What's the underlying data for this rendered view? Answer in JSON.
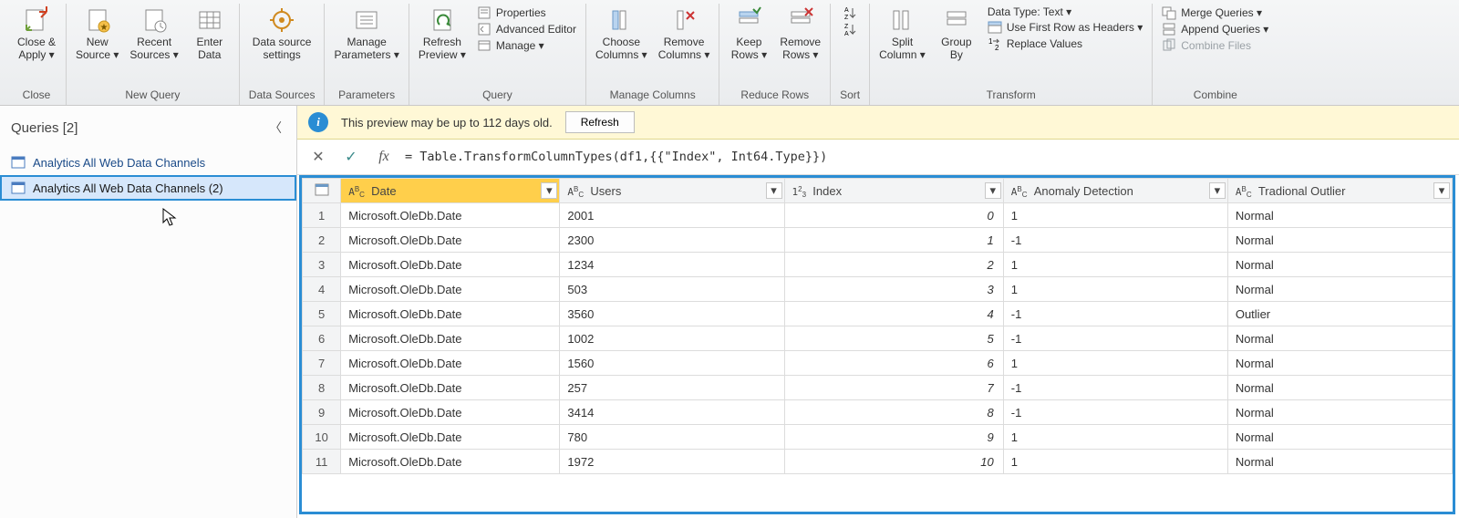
{
  "ribbon": {
    "close": {
      "close_apply": "Close &\nApply ▾",
      "group": "Close"
    },
    "newquery": {
      "new_source": "New\nSource ▾",
      "recent": "Recent\nSources ▾",
      "enter": "Enter\nData",
      "group": "New Query"
    },
    "datasources": {
      "btn": "Data source\nsettings",
      "group": "Data Sources"
    },
    "parameters": {
      "btn": "Manage\nParameters ▾",
      "group": "Parameters"
    },
    "query": {
      "refresh": "Refresh\nPreview ▾",
      "props": "Properties",
      "adv": "Advanced Editor",
      "manage": "Manage ▾",
      "group": "Query"
    },
    "managecols": {
      "choose": "Choose\nColumns ▾",
      "remove": "Remove\nColumns ▾",
      "group": "Manage Columns"
    },
    "reducerows": {
      "keep": "Keep\nRows ▾",
      "remove": "Remove\nRows ▾",
      "group": "Reduce Rows"
    },
    "sort": {
      "group": "Sort"
    },
    "transform": {
      "split": "Split\nColumn ▾",
      "group_by": "Group\nBy",
      "datatype": "Data Type: Text ▾",
      "firstrow": "Use First Row as Headers ▾",
      "replace": "Replace Values",
      "group": "Transform"
    },
    "combine": {
      "merge": "Merge Queries ▾",
      "append": "Append Queries ▾",
      "files": "Combine Files",
      "group": "Combine"
    }
  },
  "sidebar": {
    "title": "Queries [2]",
    "items": [
      {
        "label": "Analytics All Web Data Channels"
      },
      {
        "label": "Analytics All Web Data Channels (2)"
      }
    ]
  },
  "infobar": {
    "msg": "This preview may be up to 112 days old.",
    "refresh": "Refresh"
  },
  "formula": "= Table.TransformColumnTypes(df1,{{\"Index\", Int64.Type}})",
  "columns": [
    {
      "name": "Date",
      "type": "ABC",
      "selected": true
    },
    {
      "name": "Users",
      "type": "ABC"
    },
    {
      "name": "Index",
      "type": "123"
    },
    {
      "name": "Anomaly Detection",
      "type": "ABC"
    },
    {
      "name": "Tradional Outlier",
      "type": "ABC"
    }
  ],
  "rows": [
    {
      "n": 1,
      "date": "Microsoft.OleDb.Date",
      "users": "2001",
      "index": 0,
      "anom": "1",
      "trad": "Normal"
    },
    {
      "n": 2,
      "date": "Microsoft.OleDb.Date",
      "users": "2300",
      "index": 1,
      "anom": "-1",
      "trad": "Normal"
    },
    {
      "n": 3,
      "date": "Microsoft.OleDb.Date",
      "users": "1234",
      "index": 2,
      "anom": "1",
      "trad": "Normal"
    },
    {
      "n": 4,
      "date": "Microsoft.OleDb.Date",
      "users": "503",
      "index": 3,
      "anom": "1",
      "trad": "Normal"
    },
    {
      "n": 5,
      "date": "Microsoft.OleDb.Date",
      "users": "3560",
      "index": 4,
      "anom": "-1",
      "trad": "Outlier"
    },
    {
      "n": 6,
      "date": "Microsoft.OleDb.Date",
      "users": "1002",
      "index": 5,
      "anom": "-1",
      "trad": "Normal"
    },
    {
      "n": 7,
      "date": "Microsoft.OleDb.Date",
      "users": "1560",
      "index": 6,
      "anom": "1",
      "trad": "Normal"
    },
    {
      "n": 8,
      "date": "Microsoft.OleDb.Date",
      "users": "257",
      "index": 7,
      "anom": "-1",
      "trad": "Normal"
    },
    {
      "n": 9,
      "date": "Microsoft.OleDb.Date",
      "users": "3414",
      "index": 8,
      "anom": "-1",
      "trad": "Normal"
    },
    {
      "n": 10,
      "date": "Microsoft.OleDb.Date",
      "users": "780",
      "index": 9,
      "anom": "1",
      "trad": "Normal"
    },
    {
      "n": 11,
      "date": "Microsoft.OleDb.Date",
      "users": "1972",
      "index": 10,
      "anom": "1",
      "trad": "Normal"
    }
  ]
}
